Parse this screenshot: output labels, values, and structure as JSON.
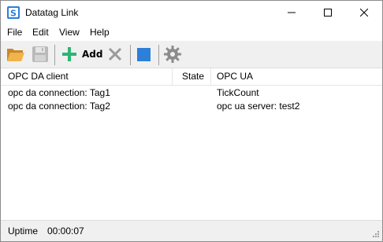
{
  "window": {
    "title": "Datatag Link",
    "icon": "app-s-icon"
  },
  "menu": {
    "file": "File",
    "edit": "Edit",
    "view": "View",
    "help": "Help"
  },
  "toolbar": {
    "add_label": "Add",
    "icons": [
      "open-folder-icon",
      "save-icon",
      "add-icon",
      "delete-icon",
      "stop-icon",
      "settings-icon"
    ]
  },
  "table": {
    "headers": {
      "client": "OPC DA client",
      "state": "State",
      "ua": "OPC UA"
    },
    "rows": [
      {
        "client": "opc da connection: Tag1",
        "state": "",
        "ua": "TickCount"
      },
      {
        "client": "opc da connection: Tag2",
        "state": "",
        "ua": "opc ua server: test2"
      }
    ]
  },
  "status": {
    "label": "Uptime",
    "value": "00:00:07"
  },
  "colors": {
    "accent_blue": "#2d7fd8",
    "add_green": "#2bb673",
    "folder_orange": "#e8a33c"
  }
}
